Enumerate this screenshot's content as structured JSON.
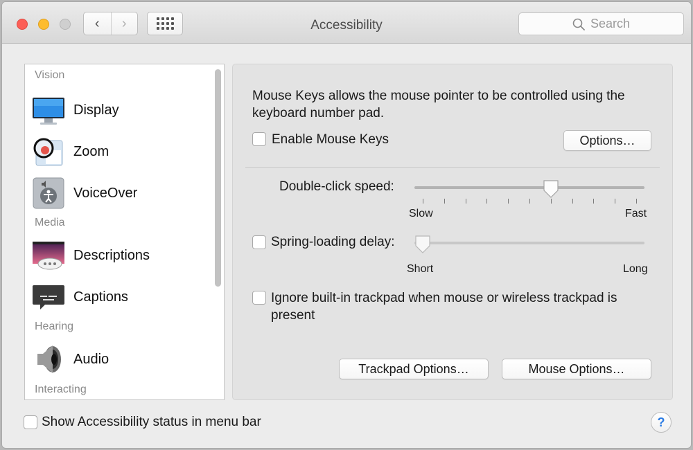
{
  "window": {
    "title": "Accessibility",
    "nav_back": "‹",
    "nav_forward": "›"
  },
  "search": {
    "placeholder": "Search"
  },
  "sidebar": {
    "sections": [
      {
        "header": "Vision",
        "items": [
          {
            "label": "Display",
            "icon": "display-icon"
          },
          {
            "label": "Zoom",
            "icon": "zoom-icon"
          },
          {
            "label": "VoiceOver",
            "icon": "voiceover-icon"
          }
        ]
      },
      {
        "header": "Media",
        "items": [
          {
            "label": "Descriptions",
            "icon": "descriptions-icon"
          },
          {
            "label": "Captions",
            "icon": "captions-icon"
          }
        ]
      },
      {
        "header": "Hearing",
        "items": [
          {
            "label": "Audio",
            "icon": "audio-icon"
          }
        ]
      },
      {
        "header": "Interacting",
        "items": []
      }
    ]
  },
  "pane": {
    "description": "Mouse Keys allows the mouse pointer to be controlled using the keyboard number pad.",
    "enable_mouse_keys": {
      "label": "Enable Mouse Keys",
      "checked": false
    },
    "options_button": "Options…",
    "double_click": {
      "label": "Double-click speed:",
      "min_label": "Slow",
      "max_label": "Fast",
      "value": 0.6
    },
    "spring_loading": {
      "label": "Spring-loading delay:",
      "min_label": "Short",
      "max_label": "Long",
      "value": 0.0,
      "checked": false
    },
    "ignore_trackpad": {
      "label": "Ignore built-in trackpad when mouse or wireless trackpad is present",
      "checked": false
    },
    "trackpad_options_button": "Trackpad Options…",
    "mouse_options_button": "Mouse Options…"
  },
  "footer": {
    "status_checkbox": {
      "label": "Show Accessibility status in menu bar",
      "checked": false
    },
    "help_label": "?"
  },
  "colors": {
    "accent": "#2a7be4",
    "close": "#fc5f57",
    "minimize": "#fdbc2e"
  }
}
